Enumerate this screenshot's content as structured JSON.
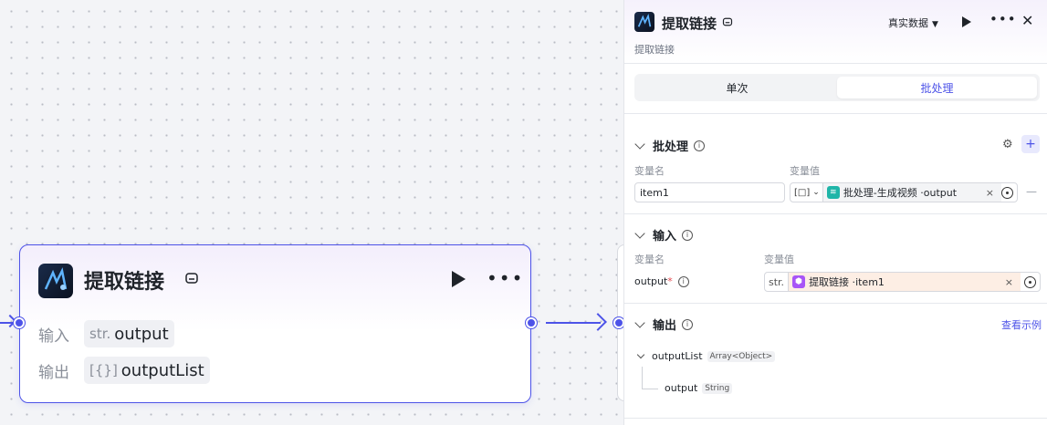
{
  "canvas": {
    "node": {
      "title": "提取链接",
      "input_label": "输入",
      "input_type": "str.",
      "input_name": "output",
      "output_label": "输出",
      "output_type": "[{}]",
      "output_name": "outputList"
    }
  },
  "panel": {
    "title": "提取链接",
    "subtitle": "提取链接",
    "data_mode": "真实数据",
    "tabs": [
      {
        "label": "单次",
        "active": false
      },
      {
        "label": "批处理",
        "active": true
      }
    ],
    "batch": {
      "title": "批处理",
      "col_name": "变量名",
      "col_value": "变量值",
      "row": {
        "name": "item1",
        "type_icon": "[□]",
        "ref_text": "批处理-生成视频 · ",
        "ref_var": "output"
      }
    },
    "input": {
      "title": "输入",
      "col_name": "变量名",
      "col_value": "变量值",
      "row": {
        "name": "output",
        "required": "*",
        "type": "str.",
        "ref_text": "提取链接 · ",
        "ref_var": "item1"
      }
    },
    "output": {
      "title": "输出",
      "view_example": "查看示例",
      "items": [
        {
          "name": "outputList",
          "type": "Array<Object>"
        },
        {
          "name": "output",
          "type": "String"
        }
      ]
    }
  },
  "colors": {
    "accent": "#4d53e8",
    "batch_ref_badge": "#1fb5a8",
    "input_ref_badge": "#a855f7",
    "input_ref_bg": "#fdeee4"
  }
}
